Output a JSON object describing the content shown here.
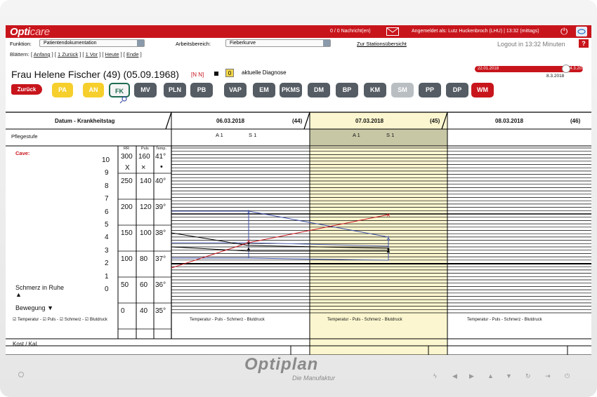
{
  "header": {
    "logo_bold": "Opti",
    "logo_light": "care",
    "messages": "0 / 0 Nachricht(en)",
    "logged_in": "Angemeldet als: Lutz Huckenbroch (LHU) | 13:32 (mittags)"
  },
  "funcbar": {
    "function_label": "Funktion:",
    "function_value": "Patientendokumentation",
    "area_label": "Arbeitsbereich:",
    "area_value": "Fieberkurve",
    "station_link": "Zur Stationsübersicht",
    "logout_text": "Logout in 13:32 Minuten",
    "help": "?"
  },
  "nav": {
    "prefix": "Blättern:",
    "items": [
      "Anfang",
      "1 Zurück",
      "1 Vor",
      "Heute",
      "Ende"
    ]
  },
  "patient": {
    "name": "Frau Helene Fischer (49) (05.09.1968)",
    "flags": "[N N]",
    "badge": "0",
    "diagnosis": "aktuelle Diagnose"
  },
  "timeline": {
    "start": "22.01.2018",
    "end": "14.3.2018",
    "current": "8.3.2018",
    "position": 0.93
  },
  "toolbar": {
    "back": "Zurück",
    "buttons": [
      "PA",
      "AN",
      "FK",
      "MV",
      "PLN",
      "PB",
      "VAP",
      "EM",
      "PKMS",
      "DM",
      "BP",
      "KM",
      "SM",
      "PP",
      "DP",
      "WM"
    ]
  },
  "chart": {
    "col_header": "Datum - Krankheitstag",
    "pflegestufe": "Pflegestufe",
    "cave": "Cave:",
    "days": [
      {
        "date": "06.03.2018",
        "day": "(44)",
        "a": "A 1",
        "s": "S 1",
        "legend": "Temperatur - Puls - Schmerz - Blutdruck"
      },
      {
        "date": "07.03.2018",
        "day": "(45)",
        "a": "A 1",
        "s": "S 1",
        "legend": "Temperatur - Puls - Schmerz - Blutdruck"
      },
      {
        "date": "08.03.2018",
        "day": "(46)",
        "a": "",
        "s": "",
        "legend": "Temperatur - Puls - Schmerz - Blutdruck"
      }
    ],
    "scale_headers": {
      "rr": "RR",
      "puls": "Puls",
      "temp": "Temp."
    },
    "scale_top": {
      "rr": "300",
      "puls": "160",
      "temp": "41°"
    },
    "markers": {
      "rr": "X",
      "puls": "×",
      "temp": "•"
    },
    "scale_rows": [
      {
        "rr": "250",
        "puls": "140",
        "temp": "40°"
      },
      {
        "rr": "200",
        "puls": "120",
        "temp": "39°"
      },
      {
        "rr": "150",
        "puls": "100",
        "temp": "38°"
      },
      {
        "rr": "100",
        "puls": "80",
        "temp": "37°"
      },
      {
        "rr": "50",
        "puls": "60",
        "temp": "36°"
      },
      {
        "rr": "0",
        "puls": "40",
        "temp": "35°"
      }
    ],
    "pain_scale": [
      "10",
      "9",
      "8",
      "7",
      "6",
      "5",
      "4",
      "3",
      "2",
      "1",
      "0"
    ],
    "schmerz_ruhe": "Schmerz in Ruhe",
    "bewegung": "Bewegung",
    "legend_checks": [
      "Temperatur -",
      "Puls -",
      "Schmerz -",
      "Blutdruck"
    ],
    "kost": "Kost / Kal."
  },
  "device": {
    "brand": "Optiplan",
    "tagline": "Die Manufaktur"
  },
  "colors": {
    "brand_red": "#c8151c",
    "highlight": "#fbf6cf",
    "series_blue": "#3b4fa8",
    "series_red": "#c8151c",
    "series_black": "#000000"
  }
}
